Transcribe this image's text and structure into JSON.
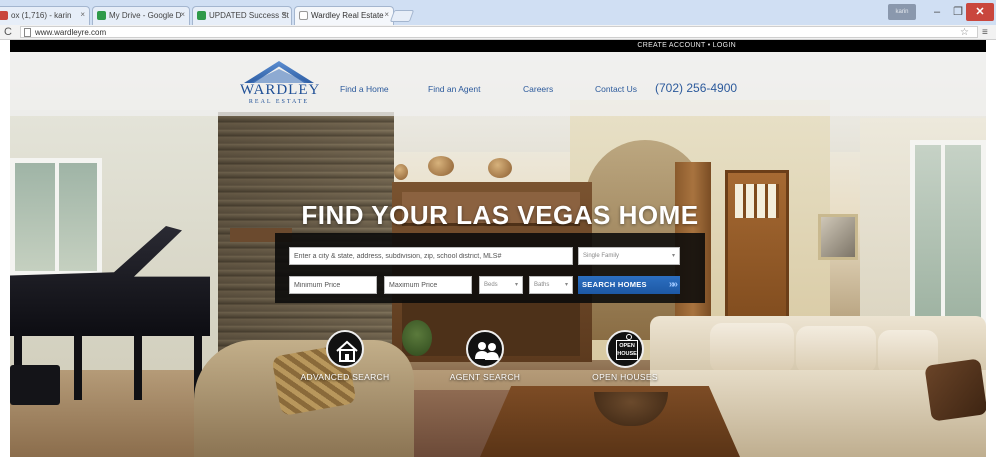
{
  "browser": {
    "tabs": [
      {
        "label": "ox (1,716) - karin",
        "favicon_color": "#c9463d",
        "active": false
      },
      {
        "label": "My Drive - Google D",
        "favicon_color": "#2f9a4a",
        "active": false
      },
      {
        "label": "UPDATED Success St",
        "favicon_color": "#2f9a4a",
        "active": false
      },
      {
        "label": "Wardley Real Estate",
        "favicon_color": "#ffffff",
        "active": true
      }
    ],
    "tab_close": "×",
    "profile_label": "karin",
    "window_controls": {
      "minimize": "–",
      "maximize": "❐",
      "close": "✕"
    },
    "reload_icon": "C",
    "url": "www.wardleyre.com",
    "star_icon": "☆",
    "menu_icon": "≡"
  },
  "site": {
    "top_link": "CREATE ACCOUNT • LOGIN",
    "logo": {
      "name": "WARDLEY",
      "tagline": "REAL ESTATE",
      "color": "#1f4f96"
    },
    "nav": [
      "Find a Home",
      "Find an Agent",
      "Careers",
      "Contact Us"
    ],
    "phone": "(702) 256-4900",
    "accent_color": "#2c5a9c"
  },
  "hero": {
    "headline": "FIND YOUR LAS VEGAS HOME",
    "search": {
      "location_placeholder": "Enter a city & state, address, subdivision, zip, school district, MLS#",
      "property_type": "Single Family",
      "min_price_placeholder": "Minimum Price",
      "max_price_placeholder": "Maximum Price",
      "beds": "Beds",
      "baths": "Baths",
      "button_label": "SEARCH HOMES",
      "button_icon": "»",
      "button_color": "#1d58a4"
    },
    "quick_links": [
      {
        "icon": "house-search-icon",
        "label": "ADVANCED SEARCH"
      },
      {
        "icon": "agents-icon",
        "label": "AGENT SEARCH"
      },
      {
        "icon": "open-house-sign-icon",
        "label": "OPEN HOUSES",
        "sign_text": "OPEN HOUSE"
      }
    ]
  }
}
